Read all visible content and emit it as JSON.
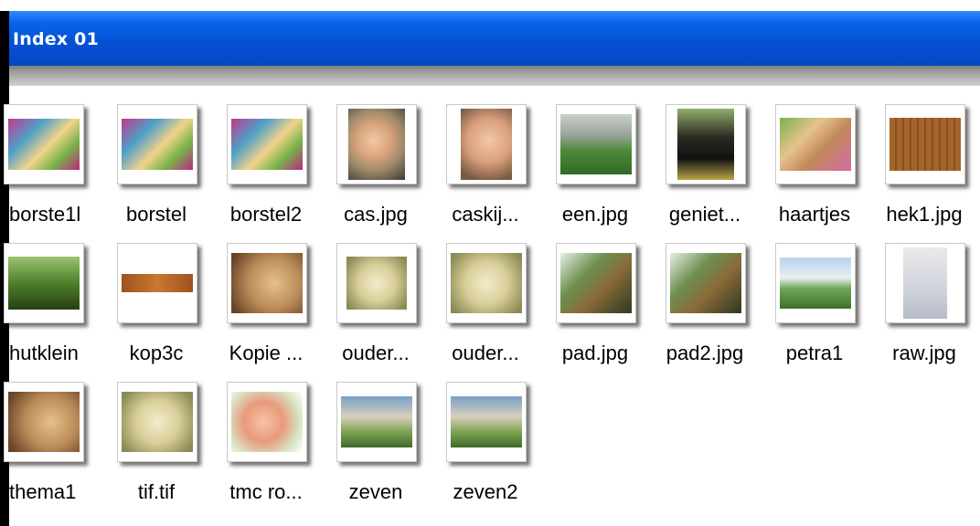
{
  "window": {
    "title": "Index 01"
  },
  "items": [
    {
      "name": "borste1l"
    },
    {
      "name": "borstel"
    },
    {
      "name": "borstel2"
    },
    {
      "name": "cas.jpg"
    },
    {
      "name": "caskij..."
    },
    {
      "name": "een.jpg"
    },
    {
      "name": "geniet..."
    },
    {
      "name": "haartjes"
    },
    {
      "name": "hek1.jpg"
    },
    {
      "name": "hutklein"
    },
    {
      "name": "kop3c"
    },
    {
      "name": "Kopie ..."
    },
    {
      "name": "ouder..."
    },
    {
      "name": "ouder..."
    },
    {
      "name": "pad.jpg"
    },
    {
      "name": "pad2.jpg"
    },
    {
      "name": "petra1"
    },
    {
      "name": "raw.jpg"
    },
    {
      "name": "thema1"
    },
    {
      "name": "tif.tif"
    },
    {
      "name": "tmc ro..."
    },
    {
      "name": "zeven"
    },
    {
      "name": "zeven2"
    }
  ],
  "colors": {
    "titlebar": "#0552d6",
    "title_text": "#ffffff",
    "strip": "#a6a6a6"
  }
}
